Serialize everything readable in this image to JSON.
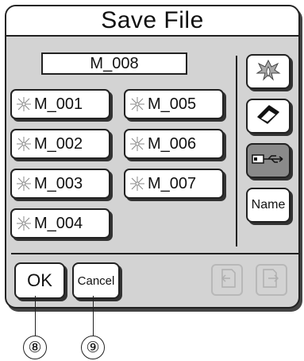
{
  "dialog": {
    "title": "Save File",
    "filename": "M_008"
  },
  "files": [
    {
      "label": "M_001",
      "icon": "flower-icon"
    },
    {
      "label": "M_002",
      "icon": "flower-icon"
    },
    {
      "label": "M_003",
      "icon": "flower-icon"
    },
    {
      "label": "M_004",
      "icon": "flower-icon"
    },
    {
      "label": "M_005",
      "icon": "flower-icon"
    },
    {
      "label": "M_006",
      "icon": "flower-icon"
    },
    {
      "label": "M_007",
      "icon": "flower-icon"
    }
  ],
  "side_buttons": {
    "machine_memory_icon": "embroidery-icon",
    "eraser_icon": "eraser-icon",
    "usb_icon": "usb-icon",
    "name_label": "Name"
  },
  "actions": {
    "ok_label": "OK",
    "cancel_label": "Cancel",
    "prev_page_icon": "prev-page-icon",
    "next_page_icon": "next-page-icon"
  },
  "callouts": {
    "ok_number": "⑧",
    "cancel_number": "⑨"
  },
  "colors": {
    "panel_bg": "#d3d3d3",
    "button_bg": "#ffffff",
    "active_bg": "#8a8a8a",
    "disabled_border": "#b8b8b8"
  }
}
